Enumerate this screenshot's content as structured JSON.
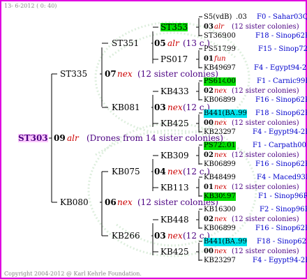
{
  "header": {
    "date": "13- 6-2012 ( 0: 40)"
  },
  "footer": {
    "copyright": "Copyright 2004-2012 @ Karl Kehrle Foundation."
  },
  "root": {
    "name": "ST303",
    "year": "09",
    "queen": "alr",
    "colonies": "(Drones from 14 sister colonies)"
  },
  "gen1": [
    {
      "name": "ST335",
      "year": "07",
      "queen": "nex",
      "colonies": "(12 sister colonies)"
    },
    {
      "name": "KB080",
      "year": "06",
      "queen": "nex",
      "colonies": "(12 sister colonies)"
    }
  ],
  "gen2": [
    {
      "name": "ST351",
      "year": "05",
      "queen": "alr",
      "colonies": "(13 c.)"
    },
    {
      "name": "KB081",
      "year": "03",
      "queen": "nex",
      "colonies": "(12 c.)"
    },
    {
      "name": "KB075",
      "year": "04",
      "queen": "nex",
      "colonies": "(12 c.)"
    },
    {
      "name": "KB266",
      "year": "03",
      "queen": "nex",
      "colonies": "(12 c.)"
    }
  ],
  "gen3": [
    {
      "name": "ST353",
      "hl": "g"
    },
    {
      "name": "PS017"
    },
    {
      "name": "KB433"
    },
    {
      "name": "KB425"
    },
    {
      "name": "KB309"
    },
    {
      "name": "KB113"
    },
    {
      "name": "KB448"
    },
    {
      "name": "KB425"
    }
  ],
  "gen4": [
    {
      "top": "S5(vdB)",
      "top_yr": ".03",
      "top_src": "F0 - Sahar03Q",
      "mid_yr": "03",
      "mid_q": "alr",
      "mid_col": "(12 sister colonies)",
      "bot": "ST369",
      "bot_yr": ".00",
      "bot_src": "F18 - Sinop62R"
    },
    {
      "top": "PS517",
      "top_yr": ".99",
      "top_src": "F15 - Sinop72R",
      "mid_yr": "01",
      "mid_q": "fun",
      "mid_col": "",
      "bot": "KB496",
      "bot_yr": ".97",
      "bot_src": "F4 - Egypt94-2R"
    },
    {
      "top": "PS614",
      "top_yr": ".00",
      "top_hl": "g",
      "top_src": "F1 - Carnic99R",
      "mid_yr": "02",
      "mid_q": "nex",
      "mid_col": "(12 sister colonies)",
      "bot": "KB068",
      "bot_yr": ".99",
      "bot_src": "F16 - Sinop62R"
    },
    {
      "top": "B441(BA)",
      "top_yr": ".99",
      "top_hl": "c",
      "top_src": "F18 - Sinop62R",
      "mid_yr": "00",
      "mid_q": "nex",
      "mid_col": "(12 sister colonies)",
      "bot": "KB232",
      "bot_yr": ".97",
      "bot_src": "F4 - Egypt94-2R"
    },
    {
      "top": "PS723",
      "top_yr": ".01",
      "top_hl": "g",
      "top_src": "F1 - Carpath00R",
      "mid_yr": "02",
      "mid_q": "nex",
      "mid_col": "(12 sister colonies)",
      "bot": "KB068",
      "bot_yr": ".99",
      "bot_src": "F16 - Sinop62R"
    },
    {
      "top": "KB484",
      "top_yr": ".99",
      "top_src": "F4 - Maced93R",
      "mid_yr": "01",
      "mid_q": "nex",
      "mid_col": "(12 sister colonies)",
      "bot": "KB309",
      "bot_yr": ".97",
      "bot_hl": "g",
      "bot_src": "F1 - Sinop96R"
    },
    {
      "top": "KB163",
      "top_yr": ".00",
      "top_src": "F2 - Sinop96R",
      "mid_yr": "02",
      "mid_q": "nex",
      "mid_col": "(12 sister colonies)",
      "bot": "KB068",
      "bot_yr": ".99",
      "bot_src": "F16 - Sinop62R"
    },
    {
      "top": "B441(BA)",
      "top_yr": ".99",
      "top_hl": "c",
      "top_src": "F18 - Sinop62R",
      "mid_yr": "00",
      "mid_q": "nex",
      "mid_col": "(12 sister colonies)",
      "bot": "KB232",
      "bot_yr": ".97",
      "bot_src": "F4 - Egypt94-2R"
    }
  ]
}
